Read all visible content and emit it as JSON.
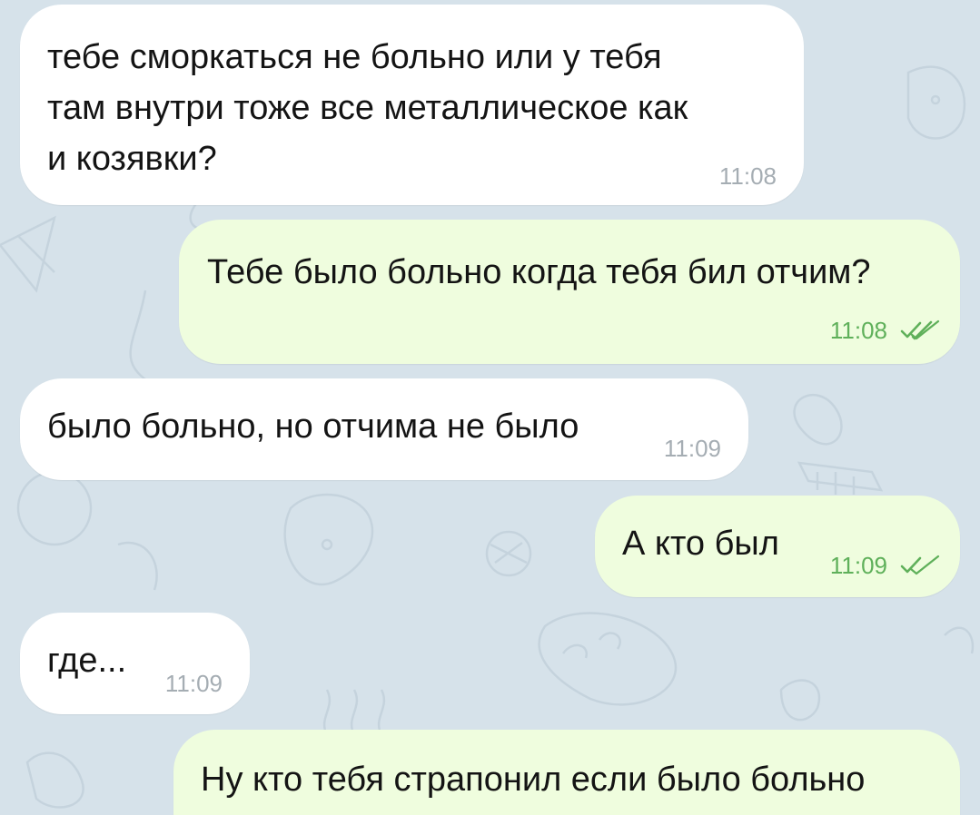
{
  "chat": {
    "messages": [
      {
        "direction": "incoming",
        "text": "тебе сморкаться не больно или у тебя\nтам внутри тоже все металлическое как\nи козявки?",
        "time": "11:08"
      },
      {
        "direction": "outgoing",
        "text": "Тебе было больно когда тебя бил отчим?",
        "time": "11:08",
        "status_icon": "double-check-icon"
      },
      {
        "direction": "incoming",
        "text": "было больно, но отчима не было",
        "time": "11:09"
      },
      {
        "direction": "outgoing",
        "text": "А кто был",
        "time": "11:09",
        "status_icon": "double-check-icon"
      },
      {
        "direction": "incoming",
        "text": "где...",
        "time": "11:09"
      },
      {
        "direction": "outgoing",
        "text": "Ну кто тебя страпонил если было больно",
        "time": ""
      }
    ]
  },
  "colors": {
    "background": "#d6e2ea",
    "incoming_bubble": "#ffffff",
    "outgoing_bubble": "#effdde",
    "incoming_time": "#a5adb3",
    "outgoing_time": "#5fb05a"
  }
}
